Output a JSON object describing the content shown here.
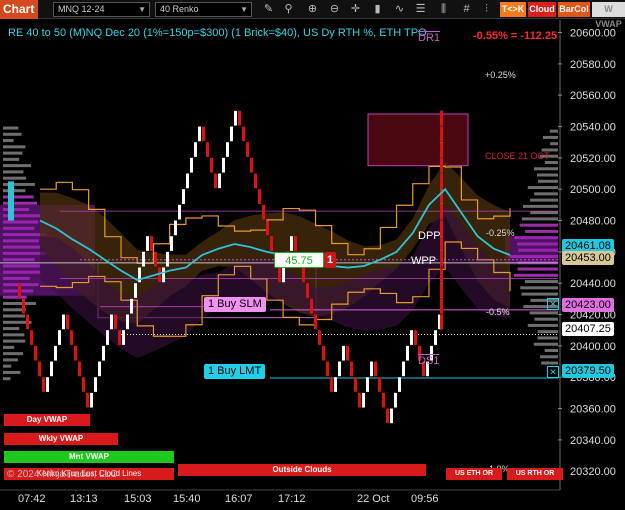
{
  "toolbar": {
    "chart_label": "Chart",
    "symbol": "MNQ 12-24",
    "bar_type": "40 Renko",
    "tc_label": "T<>K",
    "cloud_label": "Cloud",
    "barcol_label": "BarCol",
    "w_label": "W VWAP",
    "icons": [
      "pencil-icon",
      "magnifier-icon",
      "zoom-in-icon",
      "zoom-out-icon",
      "crosshair-icon",
      "chart-type-icon",
      "indicator-icon",
      "list-icon",
      "bars-icon",
      "hash-icon"
    ]
  },
  "header": {
    "title": "RE 40 to 50 (M)NQ Dec 20 (1%=150p=$300) (1 Brick=$40), US Dy RTH %, ETH TPO",
    "change": "-0.55% = -112.25"
  },
  "annotations": {
    "dr1": "DR1",
    "ds1": "DS1",
    "dpp": "DPP",
    "wpp": "WPP",
    "plus025": "+0.25%",
    "close": "CLOSE 21 OCT",
    "minus025": "-0.25%",
    "minus05": "-0.5%",
    "minus10": "-1.0%",
    "position_value": "45.75",
    "position_qty": "1",
    "copyright": "© 2024 NinjaTrader, LLC",
    "cloud_lines": "Kenko Kijun Lost Cloud Lines"
  },
  "orders": {
    "buy_slm": "1 Buy SLM",
    "buy_lmt": "1 Buy LMT",
    "close_x": "✕"
  },
  "vwap_labels": {
    "day": "Day VWAP",
    "wkly": "Wkly VWAP",
    "mnt": "Mnt VWAP",
    "outside": "Outside Clouds",
    "us_eth": "US ETH OR",
    "us_rth": "US RTH OR"
  },
  "price_badges": {
    "p1": "20461.08",
    "p2": "20453.00",
    "p3": "20423.00",
    "p4": "20407.25",
    "p5": "20379.50"
  },
  "colors": {
    "background": "#000000",
    "up_brick": "#ffffff",
    "down_brick": "#e01010",
    "ma_line": "#2ec4d6",
    "band_line": "#e89a2e",
    "vp_profile": "#c030c8",
    "order_line": "#e060e0",
    "limit_line": "#20c8e0",
    "accent_red": "#d42020"
  },
  "chart_data": {
    "type": "renko",
    "brick_size": 10,
    "y_axis": {
      "ticks": [
        20320.0,
        20340.0,
        20360.0,
        20380.0,
        20400.0,
        20420.0,
        20440.0,
        20460.0,
        20480.0,
        20500.0,
        20520.0,
        20540.0,
        20560.0,
        20580.0,
        20600.0
      ],
      "tick_labels": [
        "20320.00",
        "20340.00",
        "20360.00",
        "20380.00",
        "20400.00",
        "20420.00",
        "20440.00",
        "20460.00",
        "20480.00",
        "20500.00",
        "20520.00",
        "20540.00",
        "20560.00",
        "20580.00",
        "20600.00"
      ],
      "range": [
        20308,
        20608
      ]
    },
    "x_axis": {
      "labels": [
        "07:42",
        "13:13",
        "15:03",
        "15:40",
        "16:07",
        "17:12",
        "22 Oct",
        "09:56"
      ]
    },
    "bricks": [
      {
        "dir": "down",
        "from": 20440,
        "to": 20370
      },
      {
        "dir": "up",
        "from": 20370,
        "to": 20420
      },
      {
        "dir": "down",
        "from": 20420,
        "to": 20360
      },
      {
        "dir": "up",
        "from": 20360,
        "to": 20420
      },
      {
        "dir": "down",
        "from": 20420,
        "to": 20400
      },
      {
        "dir": "up",
        "from": 20400,
        "to": 20470
      },
      {
        "dir": "down",
        "from": 20470,
        "to": 20440
      },
      {
        "dir": "up",
        "from": 20440,
        "to": 20540
      },
      {
        "dir": "down",
        "from": 20540,
        "to": 20500
      },
      {
        "dir": "up",
        "from": 20500,
        "to": 20550
      },
      {
        "dir": "down",
        "from": 20550,
        "to": 20440
      },
      {
        "dir": "up",
        "from": 20440,
        "to": 20470
      },
      {
        "dir": "down",
        "from": 20470,
        "to": 20370
      },
      {
        "dir": "up",
        "from": 20370,
        "to": 20400
      },
      {
        "dir": "down",
        "from": 20400,
        "to": 20360
      },
      {
        "dir": "up",
        "from": 20360,
        "to": 20390
      },
      {
        "dir": "down",
        "from": 20390,
        "to": 20350
      },
      {
        "dir": "up",
        "from": 20350,
        "to": 20410
      },
      {
        "dir": "down",
        "from": 20410,
        "to": 20380
      },
      {
        "dir": "up",
        "from": 20380,
        "to": 20450
      },
      {
        "dir": "down",
        "from": 20450,
        "to": 20410
      },
      {
        "dir": "up",
        "from": 20410,
        "to": 20480
      },
      {
        "dir": "down",
        "from": 20480,
        "to": 20460
      },
      {
        "dir": "up",
        "from": 20460,
        "to": 20500
      },
      {
        "dir": "down",
        "from": 20500,
        "to": 20440
      },
      {
        "dir": "up",
        "from": 20440,
        "to": 20550
      },
      {
        "dir": "down",
        "from": 20550,
        "to": 20410
      }
    ],
    "ma_line": [
      20480,
      20475,
      20468,
      20462,
      20455,
      20448,
      20442,
      20445,
      20448,
      20450,
      20458,
      20462,
      20465,
      20463,
      20460,
      20458,
      20455,
      20452,
      20451,
      20450,
      20451,
      20455,
      20460,
      20472,
      20490,
      20500,
      20485,
      20470,
      20462,
      20458
    ],
    "levels": {
      "dpp": 20463,
      "wpp": 20453,
      "buy_slm": 20423,
      "last": 20407.25,
      "buy_lmt": 20379.5,
      "dr1": 20600,
      "ds1": 20390,
      "plus_025": 20565,
      "close_21_oct": 20518,
      "minus_025": 20466,
      "minus_05": 20417,
      "minus_10": 20315
    }
  }
}
